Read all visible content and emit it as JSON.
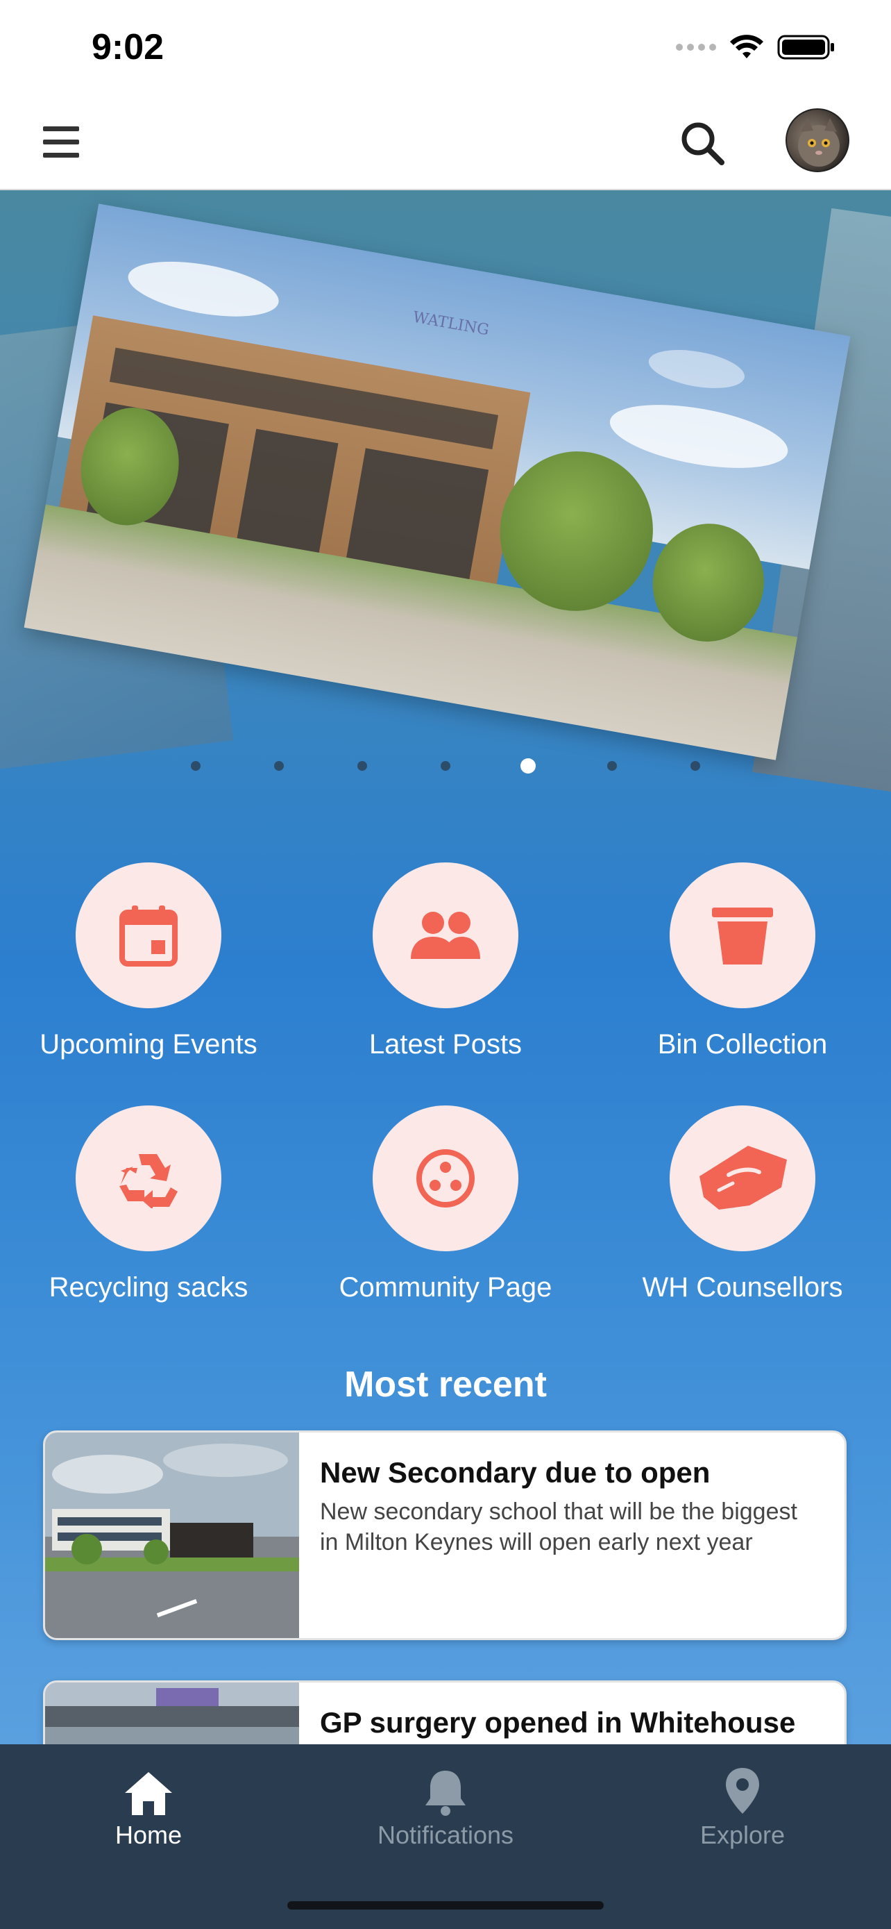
{
  "status_bar": {
    "time": "9:02"
  },
  "header": {
    "menu_icon": "hamburger-menu-icon",
    "search_icon": "search-icon",
    "avatar": "user-avatar"
  },
  "carousel": {
    "slide_count": 7,
    "active_index": 4,
    "logo_text": "WATLING"
  },
  "shortcuts": [
    {
      "label": "Upcoming Events",
      "icon": "calendar-icon"
    },
    {
      "label": "Latest Posts",
      "icon": "people-icon"
    },
    {
      "label": "Bin Collection",
      "icon": "bin-icon"
    },
    {
      "label": "Recycling sacks",
      "icon": "recycle-icon"
    },
    {
      "label": "Community Page",
      "icon": "community-icon"
    },
    {
      "label": "WH Counsellors",
      "icon": "handshake-icon"
    }
  ],
  "most_recent": {
    "title": "Most recent",
    "items": [
      {
        "title": "New Secondary due to open",
        "summary": "New secondary school that will be the biggest in Milton Keynes will open early next year"
      },
      {
        "title": "GP surgery opened in Whitehouse",
        "summary": ""
      }
    ]
  },
  "tab_bar": {
    "tabs": [
      {
        "label": "Home",
        "icon": "home-icon",
        "active": true
      },
      {
        "label": "Notifications",
        "icon": "bell-icon",
        "active": false
      },
      {
        "label": "Explore",
        "icon": "location-pin-icon",
        "active": false
      }
    ]
  },
  "colors": {
    "accent": "#f26454",
    "shortcut_bg": "#fce8e6",
    "tab_bar_bg": "#2a3d50"
  }
}
